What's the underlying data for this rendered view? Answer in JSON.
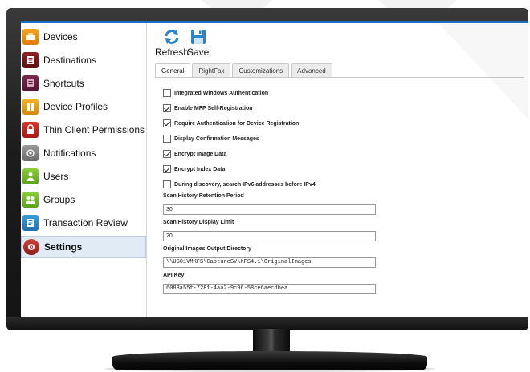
{
  "sidebar": {
    "items": [
      {
        "label": "Devices",
        "icon": "devices-icon"
      },
      {
        "label": "Destinations",
        "icon": "destinations-icon"
      },
      {
        "label": "Shortcuts",
        "icon": "shortcuts-icon"
      },
      {
        "label": "Device Profiles",
        "icon": "device-profiles-icon"
      },
      {
        "label": "Thin Client Permissions",
        "icon": "lock-icon"
      },
      {
        "label": "Notifications",
        "icon": "notifications-icon"
      },
      {
        "label": "Users",
        "icon": "users-icon"
      },
      {
        "label": "Groups",
        "icon": "groups-icon"
      },
      {
        "label": "Transaction Review",
        "icon": "transaction-review-icon"
      },
      {
        "label": "Settings",
        "icon": "settings-icon",
        "active": true
      }
    ]
  },
  "toolbar": {
    "refresh_label": "Refresh",
    "save_label": "Save"
  },
  "tabs": [
    {
      "label": "General",
      "active": true
    },
    {
      "label": "RightFax"
    },
    {
      "label": "Customizations"
    },
    {
      "label": "Advanced"
    }
  ],
  "settings": {
    "checkboxes": [
      {
        "label": "Integrated Windows Authentication",
        "checked": false
      },
      {
        "label": "Enable MFP Self-Registration",
        "checked": true
      },
      {
        "label": "Require Authentication for Device Registration",
        "checked": true
      },
      {
        "label": "Display Confirmation Messages",
        "checked": false
      },
      {
        "label": "Encrypt Image Data",
        "checked": true
      },
      {
        "label": "Encrypt Index Data",
        "checked": true
      },
      {
        "label": "During discovery, search IPv6 addresses before IPv4",
        "checked": false
      }
    ],
    "fields": [
      {
        "label": "Scan History Retention Period",
        "value": "30"
      },
      {
        "label": "Scan History Display Limit",
        "value": "20"
      },
      {
        "label": "Original Images Output Directory",
        "value": "\\\\US01VMKFS\\CaptureSV\\KFS4.1\\OriginalImages"
      },
      {
        "label": "API Key",
        "value": "6083a55f-7281-4aa2-9c96-58ce6aecdbea"
      }
    ]
  },
  "colors": {
    "accent": "#1e73be",
    "active_nav_bg": "#e1ebf6"
  }
}
